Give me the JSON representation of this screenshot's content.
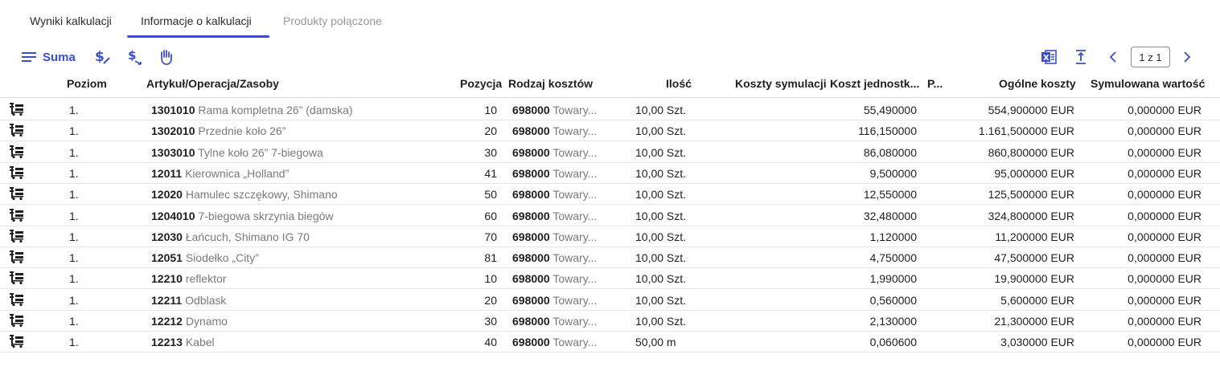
{
  "tabs": [
    {
      "label": "Wyniki kalkulacji"
    },
    {
      "label": "Informacje o kalkulacji"
    },
    {
      "label": "Produkty połączone"
    }
  ],
  "toolbar": {
    "menu_icon": "menu-lines-icon",
    "sum_label": "Suma",
    "icons": [
      "dollar-edit-icon",
      "dollar-arrow-icon",
      "hand-icon",
      "excel-icon",
      "expand-icon",
      "chevron-left-icon",
      "chevron-right-icon"
    ],
    "pager": "1 z 1"
  },
  "columns": {
    "poziom": "Poziom",
    "artykul": "Artykuł/Operacja/Zasoby",
    "pozycja": "Pozycja",
    "rodzaj": "Rodzaj kosztów",
    "ilosc": "Ilość",
    "koszty_sym": "Koszty symulacji",
    "koszt_jedn": "Koszt jednostk...",
    "p": "P...",
    "ogolne": "Ogólne koszty",
    "sym_wart": "Symulowana wartość"
  },
  "rows": [
    {
      "level": "1.",
      "code": "1301010",
      "name": "Rama kompletna 26” (damska)",
      "pos": "10",
      "cost_code": "698000",
      "cost_name": "Towary...",
      "qty": "10,00 Szt.",
      "unit_cost": "55,490000",
      "total": "554,900000 EUR",
      "sim_value": "0,000000 EUR"
    },
    {
      "level": "1.",
      "code": "1302010",
      "name": "Przednie koło 26”",
      "pos": "20",
      "cost_code": "698000",
      "cost_name": "Towary...",
      "qty": "10,00 Szt.",
      "unit_cost": "116,150000",
      "total": "1.161,500000 EUR",
      "sim_value": "0,000000 EUR"
    },
    {
      "level": "1.",
      "code": "1303010",
      "name": "Tylne koło 26” 7-biegowa",
      "pos": "30",
      "cost_code": "698000",
      "cost_name": "Towary...",
      "qty": "10,00 Szt.",
      "unit_cost": "86,080000",
      "total": "860,800000 EUR",
      "sim_value": "0,000000 EUR"
    },
    {
      "level": "1.",
      "code": "12011",
      "name": "Kierownica „Holland”",
      "pos": "41",
      "cost_code": "698000",
      "cost_name": "Towary...",
      "qty": "10,00 Szt.",
      "unit_cost": "9,500000",
      "total": "95,000000 EUR",
      "sim_value": "0,000000 EUR"
    },
    {
      "level": "1.",
      "code": "12020",
      "name": "Hamulec szczękowy, Shimano",
      "pos": "50",
      "cost_code": "698000",
      "cost_name": "Towary...",
      "qty": "10,00 Szt.",
      "unit_cost": "12,550000",
      "total": "125,500000 EUR",
      "sim_value": "0,000000 EUR"
    },
    {
      "level": "1.",
      "code": "1204010",
      "name": "7-biegowa skrzynia biegów",
      "pos": "60",
      "cost_code": "698000",
      "cost_name": "Towary...",
      "qty": "10,00 Szt.",
      "unit_cost": "32,480000",
      "total": "324,800000 EUR",
      "sim_value": "0,000000 EUR"
    },
    {
      "level": "1.",
      "code": "12030",
      "name": "Łańcuch, Shimano IG 70",
      "pos": "70",
      "cost_code": "698000",
      "cost_name": "Towary...",
      "qty": "10,00 Szt.",
      "unit_cost": "1,120000",
      "total": "11,200000 EUR",
      "sim_value": "0,000000 EUR"
    },
    {
      "level": "1.",
      "code": "12051",
      "name": "Siodełko „City”",
      "pos": "81",
      "cost_code": "698000",
      "cost_name": "Towary...",
      "qty": "10,00 Szt.",
      "unit_cost": "4,750000",
      "total": "47,500000 EUR",
      "sim_value": "0,000000 EUR"
    },
    {
      "level": "1.",
      "code": "12210",
      "name": "reflektor",
      "pos": "10",
      "cost_code": "698000",
      "cost_name": "Towary...",
      "qty": "10,00 Szt.",
      "unit_cost": "1,990000",
      "total": "19,900000 EUR",
      "sim_value": "0,000000 EUR"
    },
    {
      "level": "1.",
      "code": "12211",
      "name": "Odblask",
      "pos": "20",
      "cost_code": "698000",
      "cost_name": "Towary...",
      "qty": "10,00 Szt.",
      "unit_cost": "0,560000",
      "total": "5,600000 EUR",
      "sim_value": "0,000000 EUR"
    },
    {
      "level": "1.",
      "code": "12212",
      "name": "Dynamo",
      "pos": "30",
      "cost_code": "698000",
      "cost_name": "Towary...",
      "qty": "10,00 Szt.",
      "unit_cost": "2,130000",
      "total": "21,300000 EUR",
      "sim_value": "0,000000 EUR"
    },
    {
      "level": "1.",
      "code": "12213",
      "name": "Kabel",
      "pos": "40",
      "cost_code": "698000",
      "cost_name": "Towary...",
      "qty": "50,00 m",
      "unit_cost": "0,060600",
      "total": "3,030000 EUR",
      "sim_value": "0,000000 EUR"
    }
  ],
  "colors": {
    "accent": "#3a4fc7",
    "muted_text": "#7a7a7a",
    "excel_green": "#2f6fdb"
  }
}
